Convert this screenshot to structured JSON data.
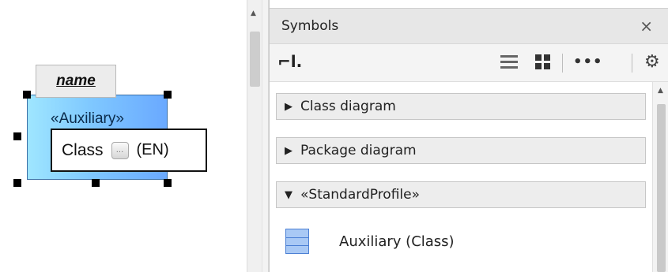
{
  "diagram": {
    "class_name": "name",
    "stereotype": "«Auxiliary»",
    "editor": {
      "text": "Class",
      "button_label": "...",
      "language": "(EN)"
    },
    "colors": {
      "class_fill_start": "#9fe6ff",
      "class_fill_end": "#6aa9ff",
      "handle": "#000000"
    }
  },
  "panel": {
    "title": "Symbols",
    "close_glyph": "×",
    "toolbar": {
      "pin_icon": "pin-icon",
      "more_label": "•••",
      "list_view_icon": "list-view-icon",
      "grid_view_icon": "grid-view-icon",
      "settings_icon": "gear-icon"
    },
    "groups": [
      {
        "label": "Class diagram",
        "expanded": false,
        "toggle": "▶"
      },
      {
        "label": "Package diagram",
        "expanded": false,
        "toggle": "▶"
      },
      {
        "label": "«StandardProfile»",
        "expanded": true,
        "toggle": "▼"
      }
    ],
    "items": [
      {
        "label": "Auxiliary (Class)",
        "icon": "class-symbol-icon"
      }
    ]
  }
}
